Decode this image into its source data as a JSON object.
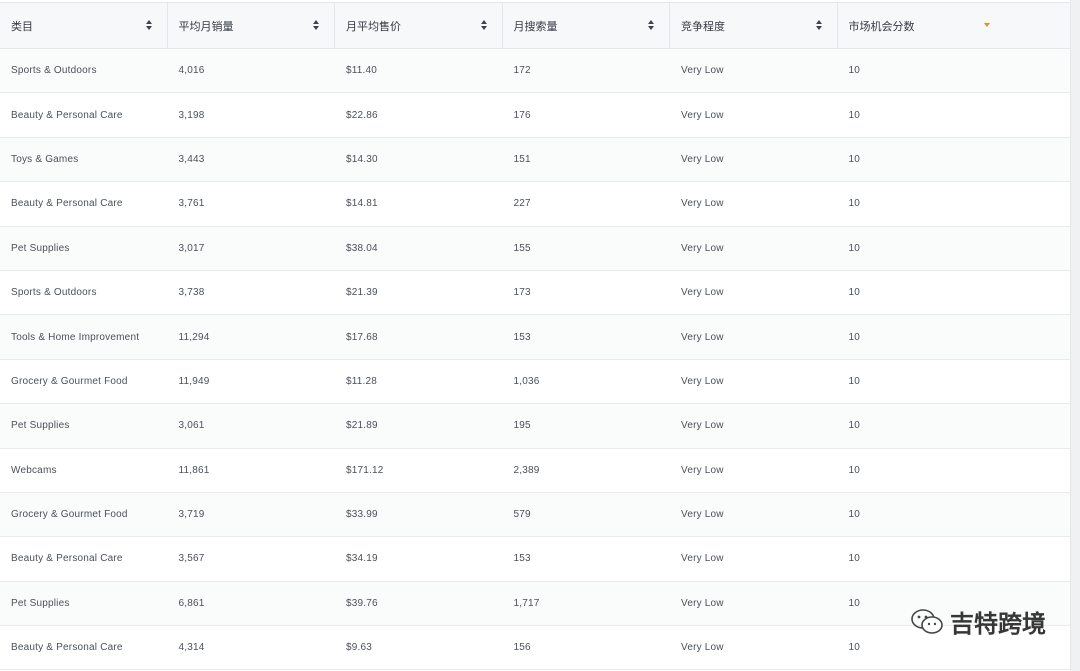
{
  "table": {
    "columns": [
      {
        "label": "类目",
        "sort": "both"
      },
      {
        "label": "平均月销量",
        "sort": "both"
      },
      {
        "label": "月平均售价",
        "sort": "both"
      },
      {
        "label": "月搜索量",
        "sort": "both"
      },
      {
        "label": "竞争程度",
        "sort": "both"
      },
      {
        "label": "市场机会分数",
        "sort": "desc-active"
      }
    ],
    "rows": [
      [
        "Sports & Outdoors",
        "4,016",
        "$11.40",
        "172",
        "Very Low",
        "10"
      ],
      [
        "Beauty & Personal Care",
        "3,198",
        "$22.86",
        "176",
        "Very Low",
        "10"
      ],
      [
        "Toys & Games",
        "3,443",
        "$14.30",
        "151",
        "Very Low",
        "10"
      ],
      [
        "Beauty & Personal Care",
        "3,761",
        "$14.81",
        "227",
        "Very Low",
        "10"
      ],
      [
        "Pet Supplies",
        "3,017",
        "$38.04",
        "155",
        "Very Low",
        "10"
      ],
      [
        "Sports & Outdoors",
        "3,738",
        "$21.39",
        "173",
        "Very Low",
        "10"
      ],
      [
        "Tools & Home Improvement",
        "11,294",
        "$17.68",
        "153",
        "Very Low",
        "10"
      ],
      [
        "Grocery & Gourmet Food",
        "11,949",
        "$11.28",
        "1,036",
        "Very Low",
        "10"
      ],
      [
        "Pet Supplies",
        "3,061",
        "$21.89",
        "195",
        "Very Low",
        "10"
      ],
      [
        "Webcams",
        "11,861",
        "$171.12",
        "2,389",
        "Very Low",
        "10"
      ],
      [
        "Grocery & Gourmet Food",
        "3,719",
        "$33.99",
        "579",
        "Very Low",
        "10"
      ],
      [
        "Beauty & Personal Care",
        "3,567",
        "$34.19",
        "153",
        "Very Low",
        "10"
      ],
      [
        "Pet Supplies",
        "6,861",
        "$39.76",
        "1,717",
        "Very Low",
        "10"
      ],
      [
        "Beauty & Personal Care",
        "4,314",
        "$9.63",
        "156",
        "Very Low",
        "10"
      ]
    ]
  },
  "colors": {
    "sort_inactive": "#3b4250",
    "sort_active": "#f08a24",
    "text": "#4a515a",
    "header_bg": "#f7f8f9",
    "border": "#e3e6ea"
  },
  "watermark": {
    "text": "吉特跨境",
    "icon": "wechat-icon"
  }
}
